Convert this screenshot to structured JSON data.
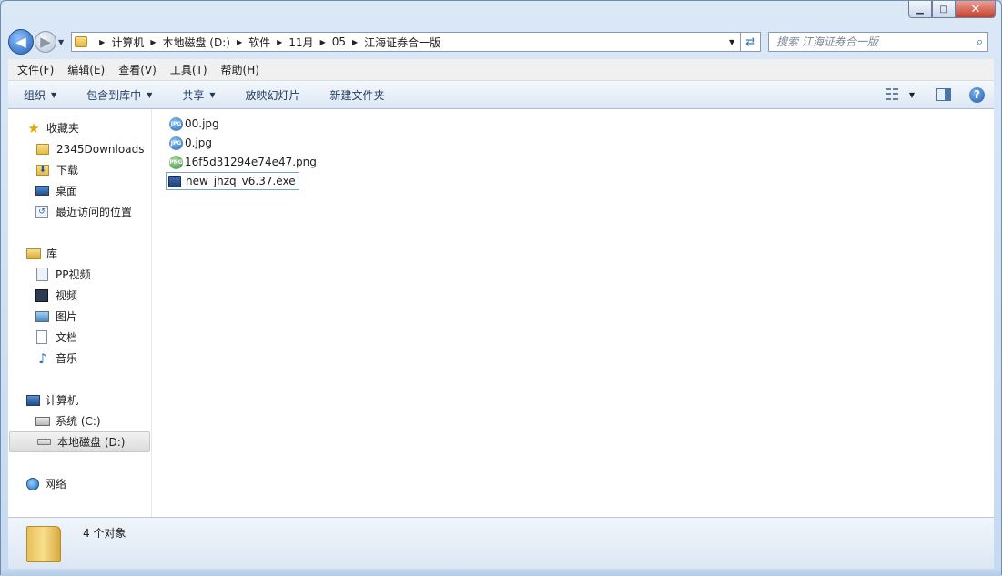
{
  "window": {
    "caption_buttons": {
      "minimize": "▁",
      "maximize": "□",
      "close": "✕"
    }
  },
  "address": {
    "crumbs": [
      "计算机",
      "本地磁盘 (D:)",
      "软件",
      "11月",
      "05",
      "江海证券合一版"
    ],
    "separator": "▶"
  },
  "search": {
    "placeholder": "搜索 江海证券合一版"
  },
  "menu": [
    "文件(F)",
    "编辑(E)",
    "查看(V)",
    "工具(T)",
    "帮助(H)"
  ],
  "commands": {
    "organize": "组织",
    "include_in_library": "包含到库中",
    "share": "共享",
    "slideshow": "放映幻灯片",
    "new_folder": "新建文件夹"
  },
  "nav": {
    "favorites": {
      "title": "收藏夹",
      "items": [
        "2345Downloads",
        "下载",
        "桌面",
        "最近访问的位置"
      ]
    },
    "libraries": {
      "title": "库",
      "items": [
        "PP视频",
        "视频",
        "图片",
        "文档",
        "音乐"
      ]
    },
    "computer": {
      "title": "计算机",
      "items": [
        "系统 (C:)",
        "本地磁盘 (D:)"
      ]
    },
    "network": {
      "title": "网络"
    }
  },
  "files": [
    {
      "name": "00.jpg",
      "type": "jpg",
      "icon_text": "JPG"
    },
    {
      "name": "0.jpg",
      "type": "jpg",
      "icon_text": "JPG"
    },
    {
      "name": "16f5d31294e74e47.png",
      "type": "png",
      "icon_text": "PNG"
    },
    {
      "name": "new_jhzq_v6.37.exe",
      "type": "exe",
      "icon_text": ""
    }
  ],
  "status": {
    "count_text": "4 个对象"
  }
}
